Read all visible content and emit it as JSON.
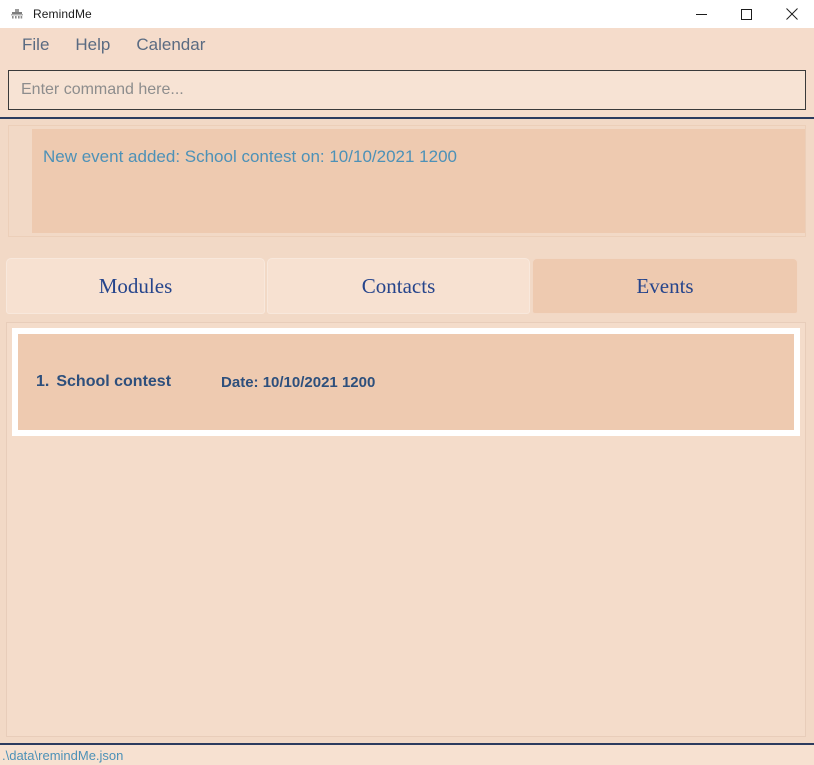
{
  "window": {
    "title": "RemindMe",
    "icon": "app-icon",
    "controls": {
      "minimize": "minimize-icon",
      "maximize": "maximize-icon",
      "close": "close-icon"
    }
  },
  "menu": {
    "items": [
      {
        "label": "File"
      },
      {
        "label": "Help"
      },
      {
        "label": "Calendar"
      }
    ]
  },
  "command": {
    "placeholder": "Enter command here...",
    "value": ""
  },
  "result": {
    "message": "New event added: School contest on: 10/10/2021 1200",
    "text_color": "#4d91b7"
  },
  "tabs": {
    "active": "Events",
    "items": [
      {
        "label": "Modules",
        "selected": false
      },
      {
        "label": "Contacts",
        "selected": false
      },
      {
        "label": "Events",
        "selected": true
      }
    ]
  },
  "list": {
    "items": [
      {
        "index": "1.",
        "name": "School contest",
        "date": "Date: 10/10/2021 1200",
        "selected": true
      }
    ]
  },
  "status": {
    "file_path": ".\\data\\remindMe.json"
  },
  "theme": {
    "window_bg": "#f2d9c6",
    "panel_bg": "#f5dccb",
    "tab_bg": "#f7e1d1",
    "tab_active_bg": "#eecab0",
    "accent_blue": "#26458c",
    "item_text": "#2d4f7c",
    "info_blue": "#4d91b7",
    "divider": "#2c3b5e"
  }
}
